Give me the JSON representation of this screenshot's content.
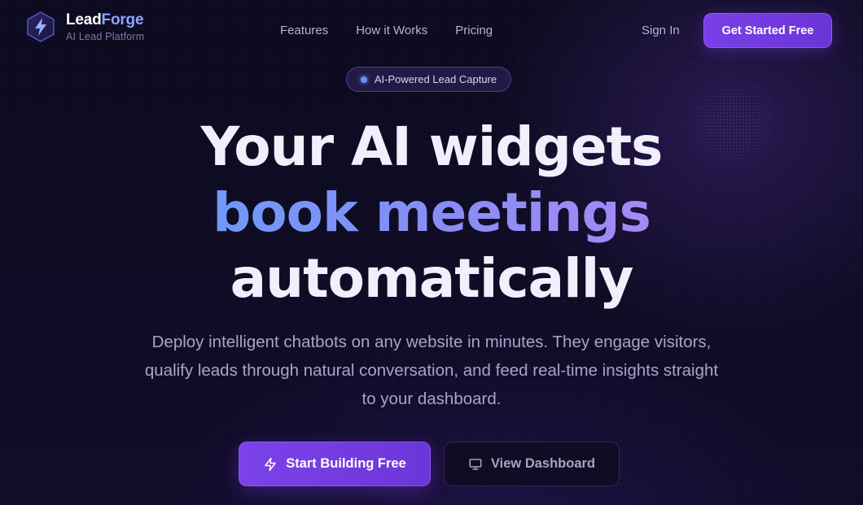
{
  "brand": {
    "name_part1": "Lead",
    "name_part2": "Forge",
    "tagline": "AI Lead Platform",
    "logo_icon": "lightning-bolt-icon"
  },
  "nav": {
    "links": [
      "Features",
      "How it Works",
      "Pricing"
    ],
    "sign_in": "Sign In",
    "cta": "Get Started Free"
  },
  "hero": {
    "badge": "AI-Powered Lead Capture",
    "headline_line1": "Your AI widgets",
    "headline_line2": "book meetings",
    "headline_line3": "automatically",
    "subtitle": "Deploy intelligent chatbots on any website in minutes. They engage visitors, qualify leads through natural conversation, and feed real-time insights straight to your dashboard.",
    "primary_button": "Start Building Free",
    "primary_icon": "zap-icon",
    "secondary_button": "View Dashboard",
    "secondary_icon": "monitor-icon"
  },
  "colors": {
    "background": "#0c0a1d",
    "accent_purple": "#7a3fe8",
    "accent_blue": "#6f99f7",
    "brand_blue": "#8aa6ff",
    "muted_text": "#a8a4c8"
  }
}
